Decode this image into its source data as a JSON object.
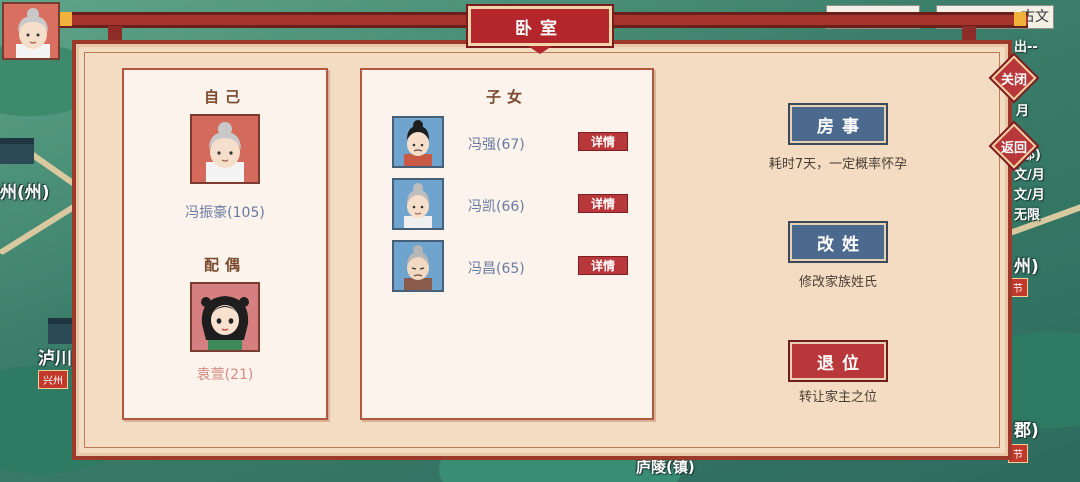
{
  "modal": {
    "title": "卧室",
    "close_label": "关闭",
    "back_label": "返回"
  },
  "self": {
    "heading": "自己",
    "name": "冯振豪(105)"
  },
  "spouse": {
    "heading": "配偶",
    "name": "袁萱(21)"
  },
  "children": {
    "heading": "子女",
    "items": [
      {
        "name": "冯强(67)",
        "detail_label": "详情"
      },
      {
        "name": "冯凯(66)",
        "detail_label": "详情"
      },
      {
        "name": "冯昌(65)",
        "detail_label": "详情"
      }
    ]
  },
  "actions": [
    {
      "label": "房事",
      "desc": "耗时7天，一定概率怀孕"
    },
    {
      "label": "改姓",
      "desc": "修改家族姓氏"
    },
    {
      "label": "退位",
      "desc": "转让家主之位"
    }
  ],
  "map": {
    "labels": {
      "left_city": "州(州)",
      "luzhou": "泸川",
      "luzhou_tag": "兴州",
      "bottom_town": "庐陵(镇)",
      "right_1": "出--",
      "right_2": "月",
      "right_3": "(郡)",
      "right_4": "文/月",
      "right_5": "文/月",
      "right_6": "无限",
      "right_7": "州)",
      "right_7_tag": "节",
      "right_8": "郡)",
      "right_8_tag": "节"
    },
    "top_right_text": "古文"
  },
  "colors": {
    "accent_red": "#b8373a",
    "accent_blue": "#4b6a8e",
    "panel_bg": "#fbf3ec",
    "modal_bg": "#f3dcc2"
  }
}
